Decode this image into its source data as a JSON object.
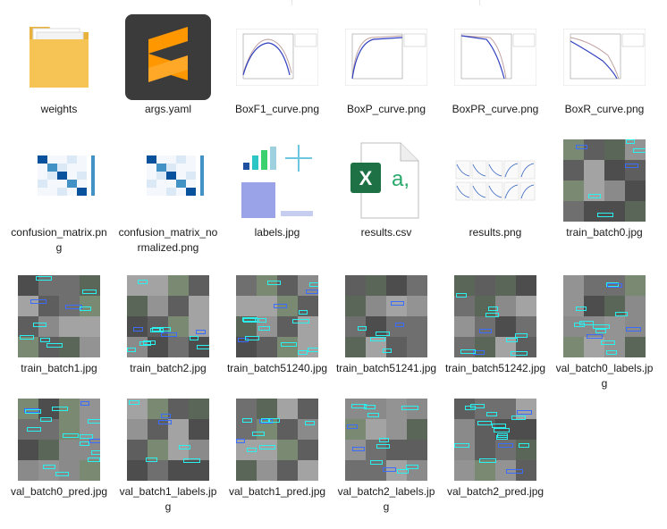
{
  "colors": {
    "folder": "#f5c454",
    "sublime_bg": "#3b3b3b",
    "sublime_logo": "#ff9800",
    "excel_green": "#1e7145",
    "cyan_box": "#2bf0f0",
    "label_text": "#1a1a1a"
  },
  "files": [
    {
      "name": "weights",
      "type": "folder",
      "icon": "folder-icon"
    },
    {
      "name": "args.yaml",
      "type": "yaml",
      "icon": "sublime-text-icon"
    },
    {
      "name": "BoxF1_curve.png",
      "type": "curve",
      "icon": "image-thumbnail"
    },
    {
      "name": "BoxP_curve.png",
      "type": "curve",
      "icon": "image-thumbnail"
    },
    {
      "name": "BoxPR_curve.png",
      "type": "curve",
      "icon": "image-thumbnail"
    },
    {
      "name": "BoxR_curve.png",
      "type": "curve",
      "icon": "image-thumbnail"
    },
    {
      "name": "confusion_matrix.png",
      "type": "matrix",
      "icon": "image-thumbnail"
    },
    {
      "name": "confusion_matrix_normalized.png",
      "type": "matrix",
      "icon": "image-thumbnail"
    },
    {
      "name": "labels.jpg",
      "type": "labels",
      "icon": "image-thumbnail"
    },
    {
      "name": "results.csv",
      "type": "csv",
      "icon": "excel-csv-icon"
    },
    {
      "name": "results.png",
      "type": "results",
      "icon": "image-thumbnail"
    },
    {
      "name": "train_batch0.jpg",
      "type": "photo",
      "icon": "image-thumbnail"
    },
    {
      "name": "train_batch1.jpg",
      "type": "photo",
      "icon": "image-thumbnail"
    },
    {
      "name": "train_batch2.jpg",
      "type": "photo",
      "icon": "image-thumbnail"
    },
    {
      "name": "train_batch51240.jpg",
      "type": "photo",
      "icon": "image-thumbnail"
    },
    {
      "name": "train_batch51241.jpg",
      "type": "photo",
      "icon": "image-thumbnail"
    },
    {
      "name": "train_batch51242.jpg",
      "type": "photo",
      "icon": "image-thumbnail"
    },
    {
      "name": "val_batch0_labels.jpg",
      "type": "photo",
      "icon": "image-thumbnail"
    },
    {
      "name": "val_batch0_pred.jpg",
      "type": "photo",
      "icon": "image-thumbnail"
    },
    {
      "name": "val_batch1_labels.jpg",
      "type": "photo",
      "icon": "image-thumbnail"
    },
    {
      "name": "val_batch1_pred.jpg",
      "type": "photo",
      "icon": "image-thumbnail"
    },
    {
      "name": "val_batch2_labels.jpg",
      "type": "photo",
      "icon": "image-thumbnail"
    },
    {
      "name": "val_batch2_pred.jpg",
      "type": "photo",
      "icon": "image-thumbnail"
    }
  ]
}
